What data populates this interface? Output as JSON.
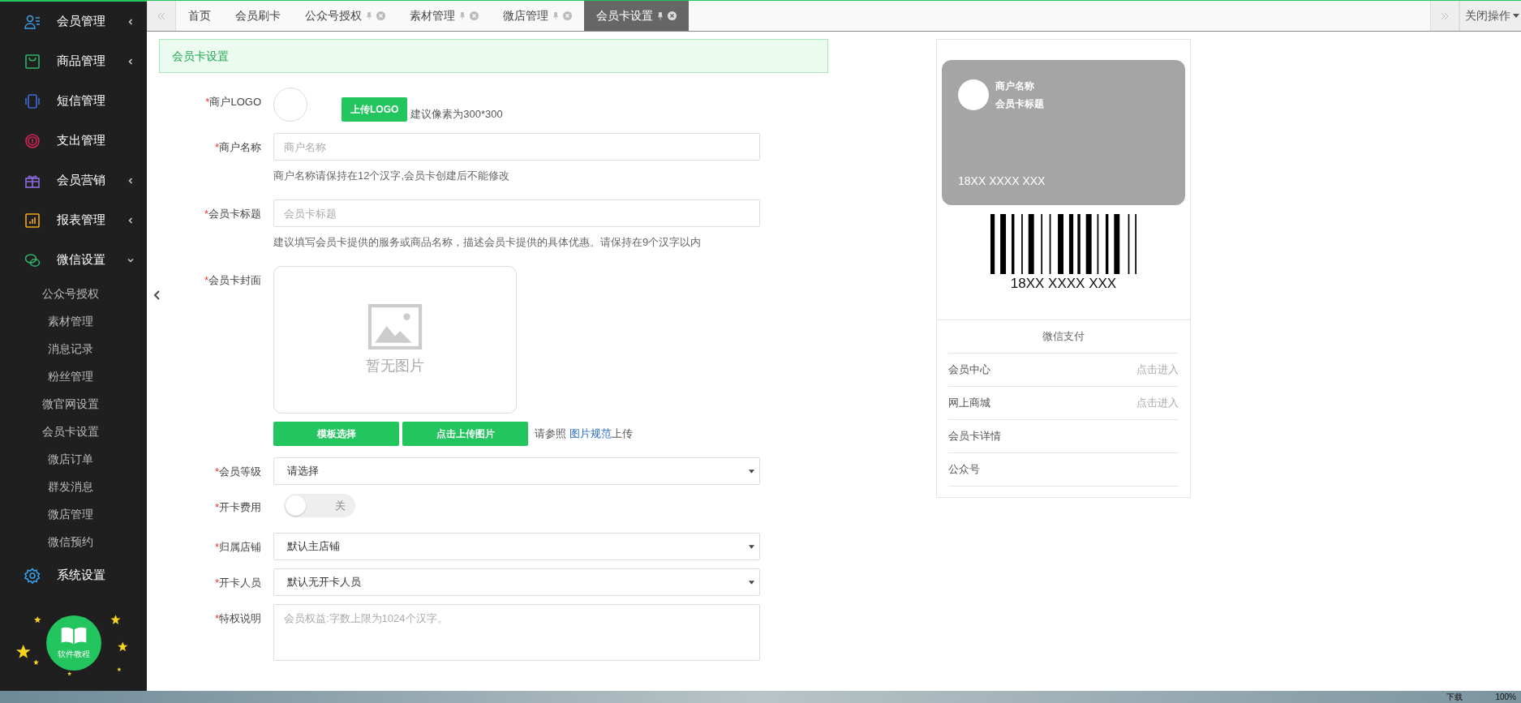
{
  "sidebar": {
    "items": [
      {
        "label": "会员管理",
        "kind": "group",
        "expanded": false
      },
      {
        "label": "商品管理",
        "kind": "group",
        "expanded": false
      },
      {
        "label": "短信管理",
        "kind": "link"
      },
      {
        "label": "支出管理",
        "kind": "link"
      },
      {
        "label": "会员营销",
        "kind": "group",
        "expanded": false
      },
      {
        "label": "报表管理",
        "kind": "group",
        "expanded": false
      },
      {
        "label": "微信设置",
        "kind": "group",
        "expanded": true,
        "children": [
          {
            "label": "公众号授权"
          },
          {
            "label": "素材管理"
          },
          {
            "label": "消息记录"
          },
          {
            "label": "粉丝管理"
          },
          {
            "label": "微官网设置"
          },
          {
            "label": "会员卡设置"
          },
          {
            "label": "微店订单"
          },
          {
            "label": "群发消息"
          },
          {
            "label": "微店管理"
          },
          {
            "label": "微信预约"
          }
        ]
      },
      {
        "label": "系统设置",
        "kind": "link"
      }
    ],
    "tutorial_badge": "软件教程"
  },
  "tabs": {
    "items": [
      {
        "label": "首页",
        "closable": false,
        "selected": false
      },
      {
        "label": "会员刷卡",
        "closable": false,
        "selected": false
      },
      {
        "label": "公众号授权",
        "closable": true,
        "selected": false
      },
      {
        "label": "素材管理",
        "closable": true,
        "selected": false
      },
      {
        "label": "微店管理",
        "closable": true,
        "selected": false
      },
      {
        "label": "会员卡设置",
        "closable": true,
        "selected": true
      }
    ],
    "close_menu": "关闭操作"
  },
  "form": {
    "header": "会员卡设置",
    "fields": [
      {
        "kind": "logo",
        "mark": "*",
        "label": "商户LOGO",
        "button": "上传LOGO",
        "hint": "建议像素为300*300"
      },
      {
        "kind": "text",
        "mark": "*",
        "label": "商户名称",
        "placeholder": "商户名称",
        "hint": "商户名称请保持在12个汉字,会员卡创建后不能修改"
      },
      {
        "kind": "text",
        "mark": "*",
        "label": "会员卡标题",
        "placeholder": "会员卡标题",
        "hint": "建议填写会员卡提供的服务或商品名称，描述会员卡提供的具体优惠。请保持在9个汉字以内"
      },
      {
        "kind": "cover",
        "mark": "*",
        "label": "会员卡封面",
        "empty_text": "暂无图片",
        "buttons": [
          "模板选择",
          "点击上传图片"
        ],
        "note_before": "请参照 ",
        "note_link": "图片规范",
        "note_after": "上传"
      },
      {
        "kind": "select",
        "mark": "*",
        "label": "会员等级",
        "value": "请选择"
      },
      {
        "kind": "switch",
        "mark": "*",
        "label": "开卡费用",
        "on": false,
        "state_text": "关"
      },
      {
        "kind": "select",
        "mark": "*",
        "label": "归属店铺",
        "value": "默认主店铺"
      },
      {
        "kind": "select",
        "mark": "*",
        "label": "开卡人员",
        "value": "默认无开卡人员"
      },
      {
        "kind": "textarea",
        "mark": "*",
        "label": "特权说明",
        "placeholder": "会员权益:字数上限为1024个汉字。"
      }
    ]
  },
  "preview": {
    "card": {
      "merchant": "商户名称",
      "title": "会员卡标题",
      "number": "18XX XXXX XXX"
    },
    "barcode_number": "18XX XXXX XXX",
    "pay_label": "微信支付",
    "rows": [
      {
        "label": "会员中心",
        "action": "点击进入"
      },
      {
        "label": "网上商城",
        "action": "点击进入"
      },
      {
        "label": "会员卡详情"
      },
      {
        "label": "公众号"
      }
    ]
  },
  "status_bar": {
    "items": [
      "下载",
      "100%"
    ]
  }
}
